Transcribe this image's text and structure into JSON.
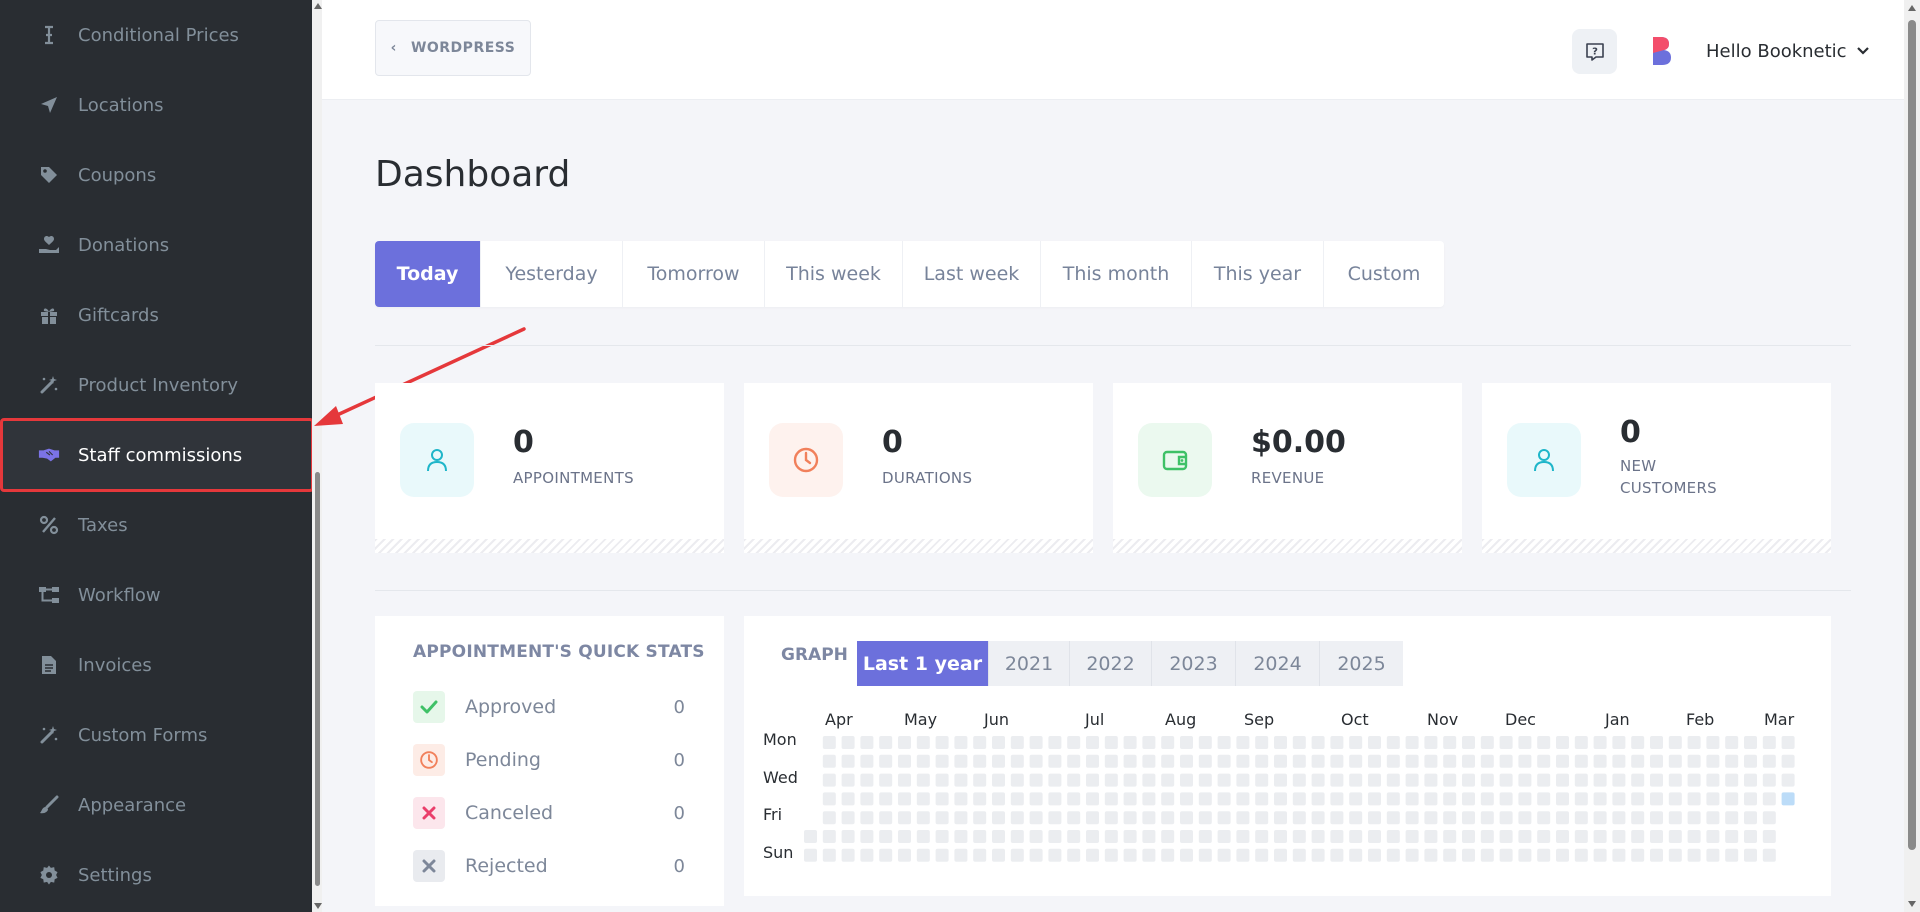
{
  "sidebar": {
    "items": [
      {
        "label": "Conditional Prices",
        "icon": "text-cursor-icon",
        "active": false
      },
      {
        "label": "Locations",
        "icon": "location-arrow-icon",
        "active": false
      },
      {
        "label": "Coupons",
        "icon": "tag-icon",
        "active": false
      },
      {
        "label": "Donations",
        "icon": "hand-holding-heart-icon",
        "active": false
      },
      {
        "label": "Giftcards",
        "icon": "gift-icon",
        "active": false
      },
      {
        "label": "Product Inventory",
        "icon": "magic-wand-icon",
        "active": false
      },
      {
        "label": "Staff commissions",
        "icon": "handshake-icon",
        "active": true
      },
      {
        "label": "Taxes",
        "icon": "percent-icon",
        "active": false
      },
      {
        "label": "Workflow",
        "icon": "workflow-icon",
        "active": false
      },
      {
        "label": "Invoices",
        "icon": "file-icon",
        "active": false
      },
      {
        "label": "Custom Forms",
        "icon": "magic-wand-icon",
        "active": false
      },
      {
        "label": "Appearance",
        "icon": "paint-brush-icon",
        "active": false
      },
      {
        "label": "Settings",
        "icon": "gear-icon",
        "active": false
      }
    ]
  },
  "header": {
    "back_label": "WORDPRESS",
    "user_greeting": "Hello Booknetic"
  },
  "page": {
    "title": "Dashboard"
  },
  "date_tabs": [
    "Today",
    "Yesterday",
    "Tomorrow",
    "This week",
    "Last week",
    "This month",
    "This year",
    "Custom"
  ],
  "date_tab_active": "Today",
  "stats": [
    {
      "value": "0",
      "label": "APPOINTMENTS",
      "icon": "user-icon",
      "color": "#1fb6c9",
      "bg": "#e9f9fb"
    },
    {
      "value": "0",
      "label": "DURATIONS",
      "icon": "clock-icon",
      "color": "#f1805b",
      "bg": "#fef2ee"
    },
    {
      "value": "$0.00",
      "label": "REVENUE",
      "icon": "wallet-icon",
      "color": "#3fc167",
      "bg": "#ebf9ef"
    },
    {
      "value": "0",
      "label": "NEW CUSTOMERS",
      "icon": "user-icon",
      "color": "#1fb6c9",
      "bg": "#e9f9fb"
    }
  ],
  "quick_stats": {
    "title": "APPOINTMENT'S QUICK STATS",
    "rows": [
      {
        "label": "Approved",
        "value": "0",
        "icon": "check-icon",
        "color": "#3fc167",
        "bg": "#e6f7ea"
      },
      {
        "label": "Pending",
        "value": "0",
        "icon": "clock-icon",
        "color": "#f1805b",
        "bg": "#fdece6"
      },
      {
        "label": "Canceled",
        "value": "0",
        "icon": "close-icon",
        "color": "#ea3f6b",
        "bg": "#fce6ec"
      },
      {
        "label": "Rejected",
        "value": "0",
        "icon": "close-icon",
        "color": "#7d8799",
        "bg": "#e9ebef"
      }
    ]
  },
  "graph": {
    "title": "GRAPH",
    "year_tabs": [
      "Last 1 year",
      "2021",
      "2022",
      "2023",
      "2024",
      "2025"
    ],
    "year_tab_active": "Last 1 year",
    "months": [
      "Apr",
      "May",
      "Jun",
      "Jul",
      "Aug",
      "Sep",
      "Oct",
      "Nov",
      "Dec",
      "Jan",
      "Feb",
      "Mar"
    ],
    "days": [
      "Mon",
      "Wed",
      "Fri",
      "Sun"
    ],
    "cell_color": "#ebedf0",
    "highlight_color": "#bcdcf8"
  }
}
